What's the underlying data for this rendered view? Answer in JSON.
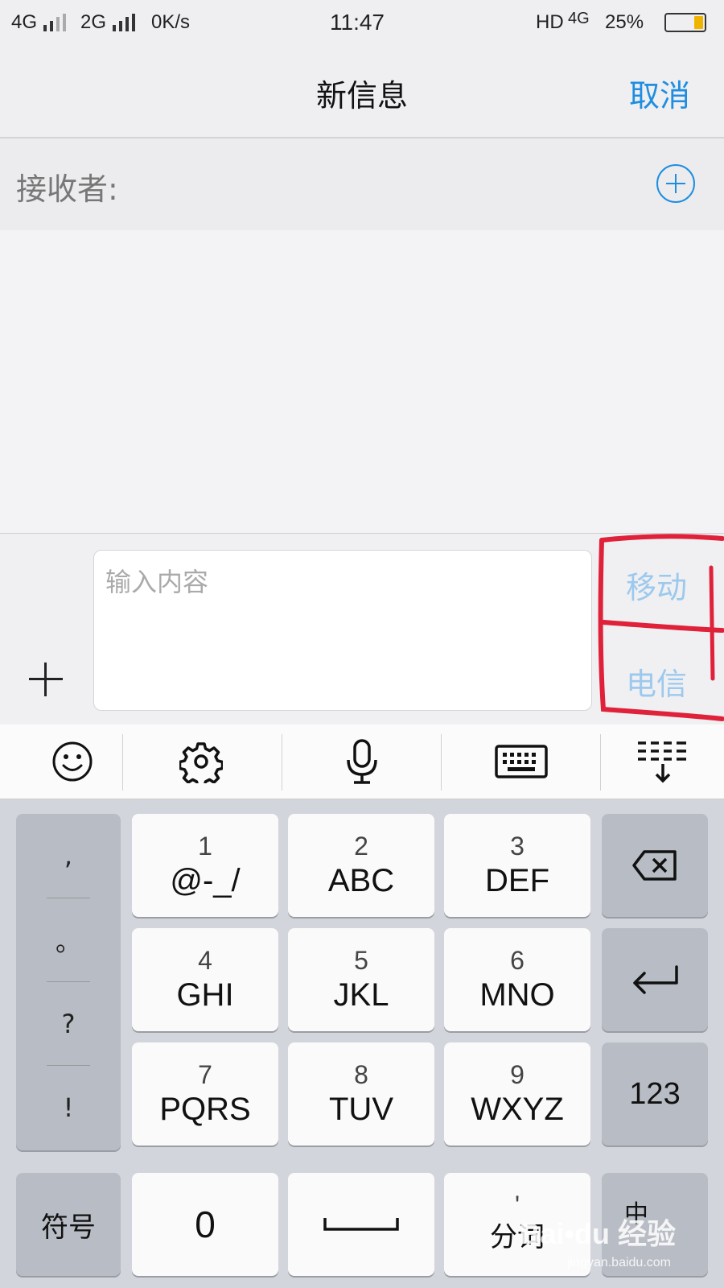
{
  "status_bar": {
    "sim1_network": "4G",
    "sim2_network": "2G",
    "speed": "0K/s",
    "time": "11:47",
    "hd_label": "HD",
    "lte_label": "4G",
    "battery_percent": "25%",
    "battery_level": 0.25
  },
  "nav": {
    "title": "新信息",
    "cancel_label": "取消"
  },
  "recipient": {
    "label": "接收者:"
  },
  "compose": {
    "placeholder": "输入内容",
    "send_mobile_label": "移动",
    "send_telecom_label": "电信"
  },
  "keyboard_toolbar": {
    "items": [
      "emoji-icon",
      "settings-gear-icon",
      "microphone-icon",
      "keyboard-icon",
      "collapse-keyboard-icon"
    ]
  },
  "keyboard": {
    "punctuation": [
      ",",
      "。",
      "?",
      "!"
    ],
    "keys": [
      {
        "num": "1",
        "letters": "@-_/"
      },
      {
        "num": "2",
        "letters": "ABC"
      },
      {
        "num": "3",
        "letters": "DEF"
      },
      {
        "num": "4",
        "letters": "GHI"
      },
      {
        "num": "5",
        "letters": "JKL"
      },
      {
        "num": "6",
        "letters": "MNO"
      },
      {
        "num": "7",
        "letters": "PQRS"
      },
      {
        "num": "8",
        "letters": "TUV"
      },
      {
        "num": "9",
        "letters": "WXYZ"
      }
    ],
    "symbols_label": "符号",
    "zero_label": "0",
    "split_word_top": "'",
    "split_word_label": "分词",
    "numeric_label": "123",
    "lang_label": "中"
  },
  "colors": {
    "accent": "#1f8ee0",
    "annotation_red": "#e0213a"
  }
}
